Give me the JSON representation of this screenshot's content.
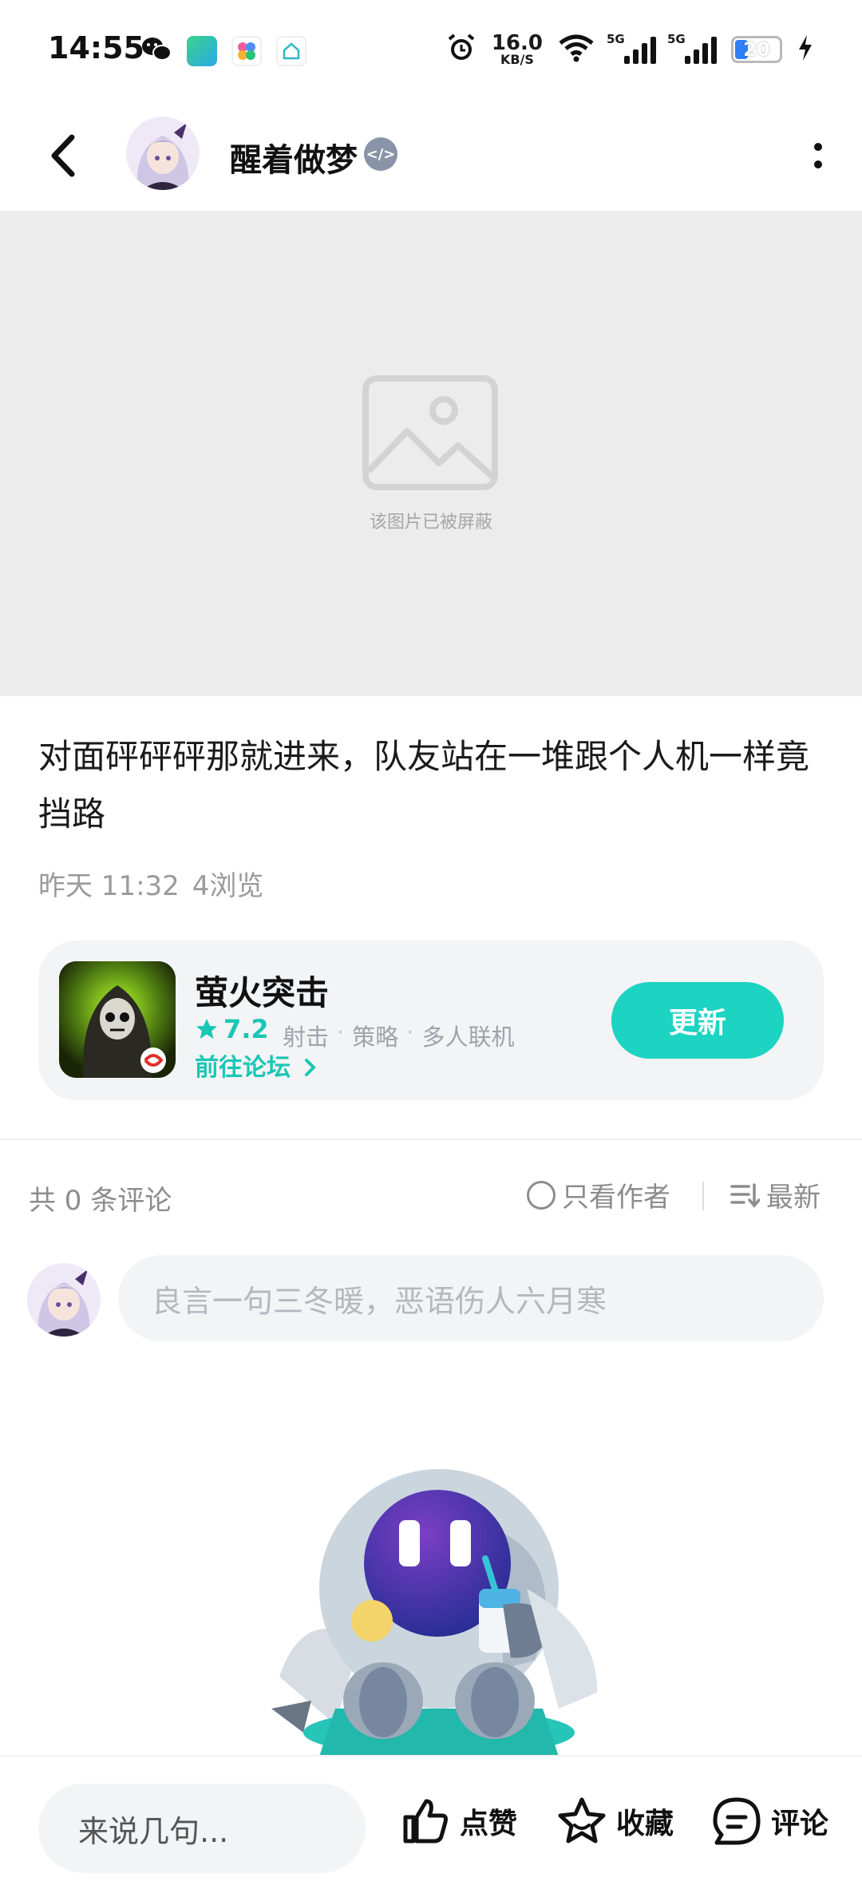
{
  "status_bar": {
    "time": "14:55",
    "net_speed_value": "16.0",
    "net_speed_unit": "KB/S",
    "signal_1": "5G",
    "signal_2": "5G",
    "battery": "20",
    "icons": [
      "wechat-icon",
      "app-icon",
      "app-icon",
      "app-icon",
      "alarm-icon",
      "wifi-icon",
      "charging-icon"
    ]
  },
  "header": {
    "author_name": "醒着做梦",
    "badge_glyph": "</>"
  },
  "post": {
    "blocked_image_text": "该图片已被屏蔽",
    "text": "对面砰砰砰那就进来，队友站在一堆跟个人机一样竟挡路",
    "time": "昨天 11:32",
    "views": "4浏览"
  },
  "game_card": {
    "name": "萤火突击",
    "rating": "7.2",
    "tags": [
      "射击",
      "策略",
      "多人联机"
    ],
    "tag_separator": "·",
    "forum_link": "前往论坛",
    "update_button": "更新"
  },
  "comments": {
    "count_text": "共 0 条评论",
    "only_author": "只看作者",
    "sort": "最新",
    "input_placeholder": "良言一句三冬暖，恶语伤人六月寒"
  },
  "bottom_bar": {
    "quick_input": "来说几句...",
    "like": "点赞",
    "favorite": "收藏",
    "comment": "评论"
  },
  "colors": {
    "accent": "#1dd3c2",
    "accent_text": "#19c7b4",
    "placeholder_bg": "#ececec",
    "card_bg": "#f3f4f6"
  }
}
